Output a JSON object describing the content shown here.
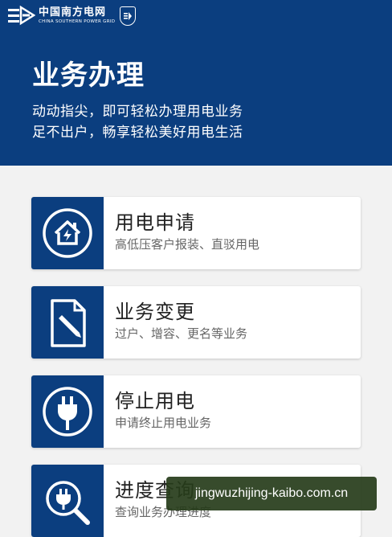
{
  "header": {
    "logo_cn": "中国南方电网",
    "logo_en": "CHINA SOUTHERN POWER GRID",
    "title": "业务办理",
    "subtitle_line1": "动动指尖，即可轻松办理用电业务",
    "subtitle_line2": "足不出户，畅享轻松美好用电生活"
  },
  "services": [
    {
      "title": "用电申请",
      "desc": "高低压客户报装、直驳用电",
      "icon": "house-icon"
    },
    {
      "title": "业务变更",
      "desc": "过户、增容、更名等业务",
      "icon": "document-edit-icon"
    },
    {
      "title": "停止用电",
      "desc": "申请终止用电业务",
      "icon": "plug-icon"
    },
    {
      "title": "进度查询",
      "desc": "查询业务办理进度",
      "icon": "search-plug-icon"
    }
  ],
  "watermark": "jingwuzhijing-kaibo.com.cn",
  "colors": {
    "brand_blue": "#0b3e7f",
    "background": "#f2f2f2"
  }
}
